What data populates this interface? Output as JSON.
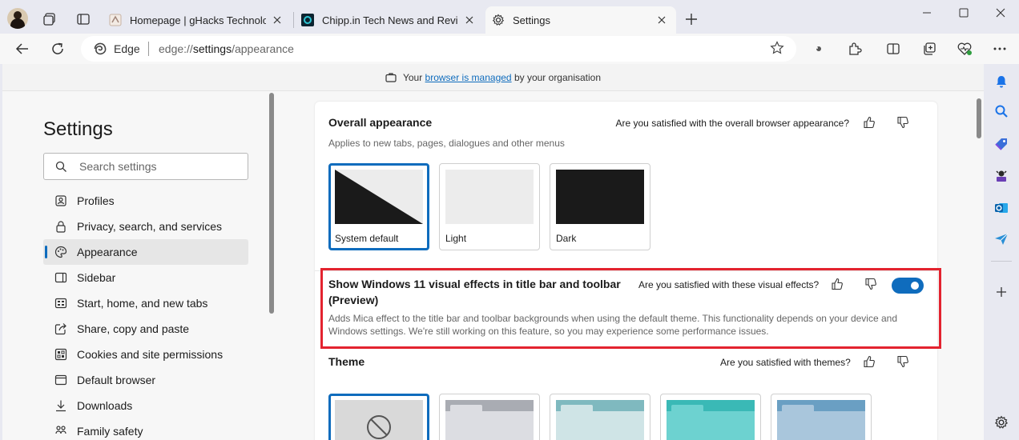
{
  "tabs": [
    {
      "title": "Homepage | gHacks Technology",
      "close_icon": "close-icon"
    },
    {
      "title": "Chipp.in Tech News and Reviews",
      "close_icon": "close-icon"
    },
    {
      "title": "Settings",
      "close_icon": "close-icon"
    }
  ],
  "address_bar": {
    "site_label": "Edge",
    "url_prefix": "edge://",
    "url_bold": "settings",
    "url_suffix": "/appearance"
  },
  "managed_bar": {
    "prefix": "Your",
    "link": "browser is managed",
    "suffix": "by your organisation"
  },
  "sidebar": {
    "title": "Settings",
    "search_placeholder": "Search settings",
    "items": [
      {
        "label": "Profiles",
        "icon": "profile-icon"
      },
      {
        "label": "Privacy, search, and services",
        "icon": "lock-icon"
      },
      {
        "label": "Appearance",
        "icon": "palette-icon",
        "active": true
      },
      {
        "label": "Sidebar",
        "icon": "sidebar-icon"
      },
      {
        "label": "Start, home, and new tabs",
        "icon": "home-icon"
      },
      {
        "label": "Share, copy and paste",
        "icon": "share-icon"
      },
      {
        "label": "Cookies and site permissions",
        "icon": "cookie-icon"
      },
      {
        "label": "Default browser",
        "icon": "browser-icon"
      },
      {
        "label": "Downloads",
        "icon": "download-icon"
      },
      {
        "label": "Family safety",
        "icon": "family-icon"
      }
    ]
  },
  "overall": {
    "title": "Overall appearance",
    "question": "Are you satisfied with the overall browser appearance?",
    "description": "Applies to new tabs, pages, dialogues and other menus",
    "options": [
      {
        "label": "System default",
        "selected": true
      },
      {
        "label": "Light",
        "selected": false
      },
      {
        "label": "Dark",
        "selected": false
      }
    ]
  },
  "visual_effects": {
    "title_line1": "Show Windows 11 visual effects in title bar and toolbar",
    "title_line2": "(Preview)",
    "question": "Are you satisfied with these visual effects?",
    "description_line1": "Adds Mica effect to the title bar and toolbar backgrounds when using the default theme. This functionality depends on your device and",
    "description_line2": "Windows settings. We're still working on this feature, so you may experience some performance issues.",
    "enabled": true
  },
  "theme": {
    "title": "Theme",
    "question": "Are you satisfied with themes?",
    "colors": [
      "#a9acb3",
      "#7fb9bf",
      "#3ab9b6",
      "#6a9fc3"
    ]
  },
  "colors": {
    "accent": "#0f6cbd",
    "highlight": "#e3232f"
  }
}
